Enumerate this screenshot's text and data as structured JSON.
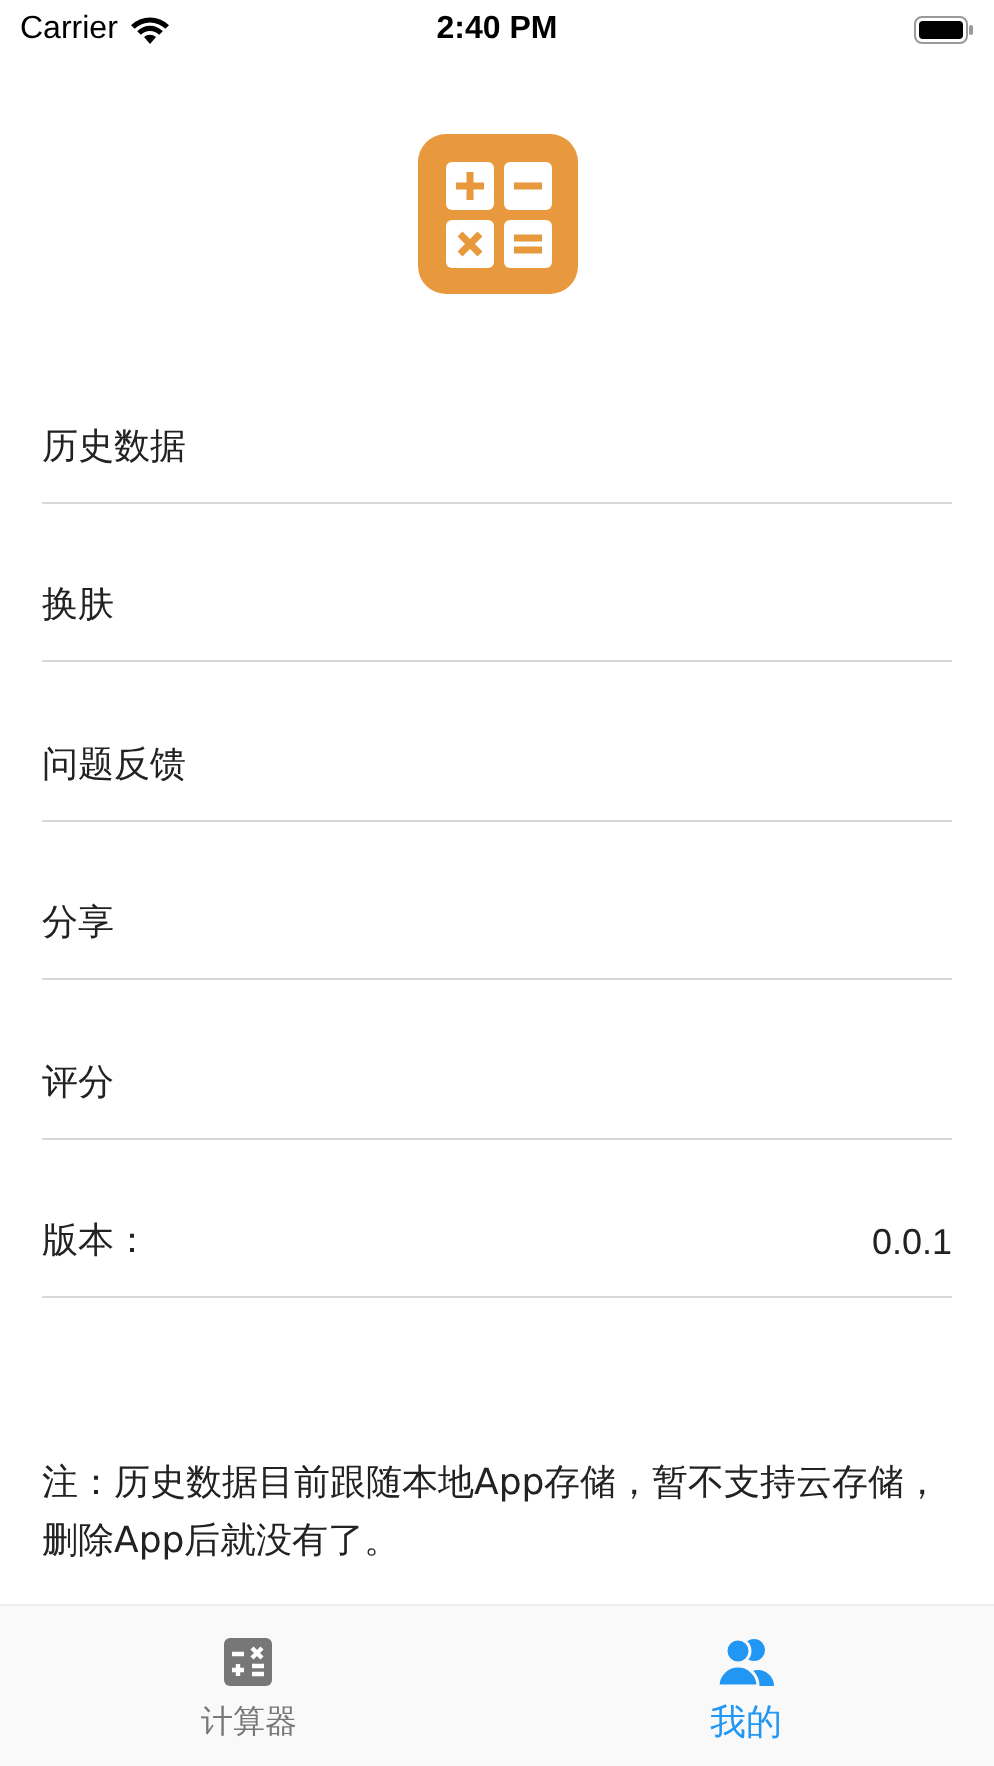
{
  "status_bar": {
    "carrier": "Carrier",
    "time": "2:40 PM"
  },
  "menu": [
    {
      "label": "历史数据"
    },
    {
      "label": "换肤"
    },
    {
      "label": "问题反馈"
    },
    {
      "label": "分享"
    },
    {
      "label": "评分"
    },
    {
      "label": "版本：",
      "value": "0.0.1"
    }
  ],
  "note": "注：历史数据目前跟随本地App存储，暂不支持云存储，删除App后就没有了。",
  "tabs": [
    {
      "label": "计算器",
      "kind": "calculator",
      "selected": false
    },
    {
      "label": "我的",
      "kind": "people",
      "selected": true
    }
  ]
}
